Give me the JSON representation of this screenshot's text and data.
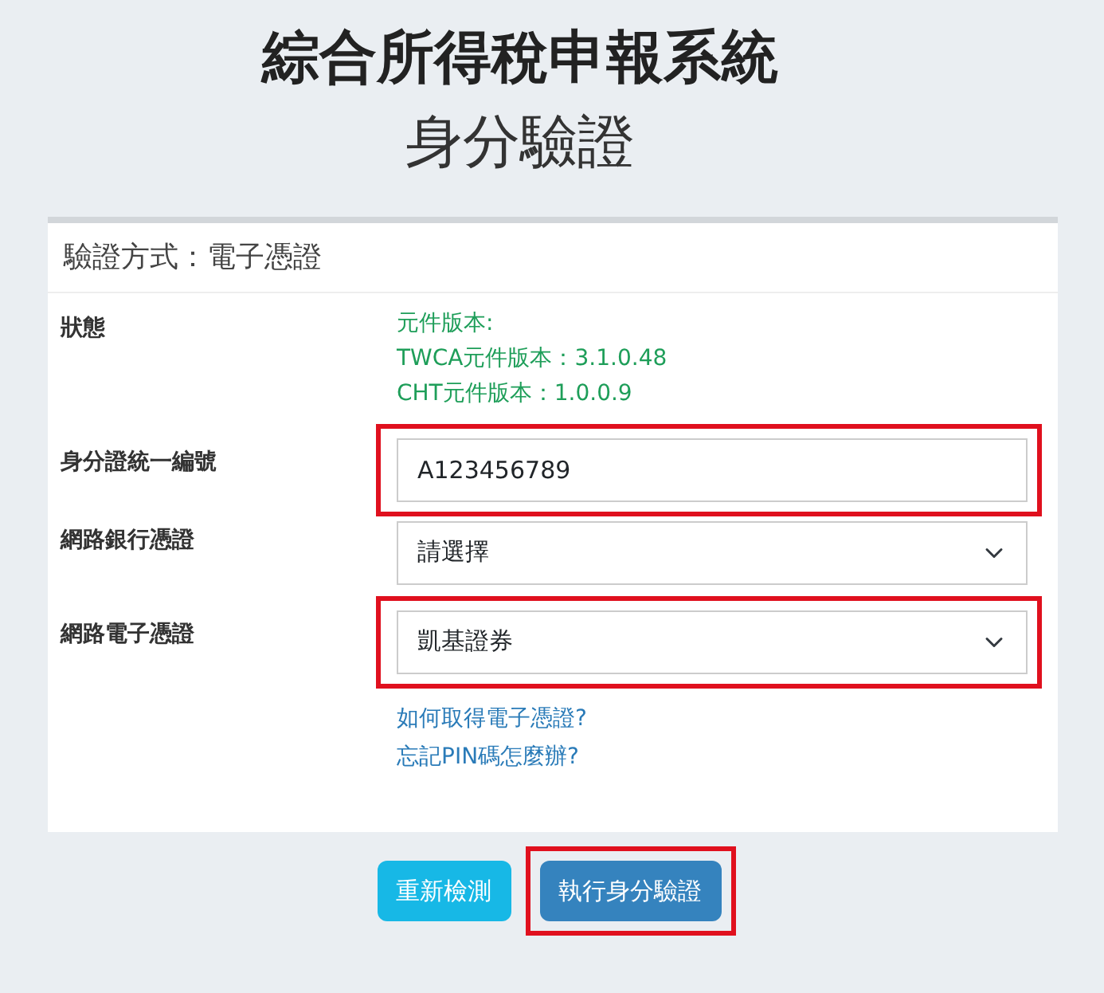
{
  "title": "綜合所得稅申報系統",
  "subtitle": "身分驗證",
  "card": {
    "header": "驗證方式：電子憑證",
    "rows": [
      {
        "kind": "status",
        "label": "狀態",
        "lines": [
          "元件版本:",
          "TWCA元件版本：3.1.0.48",
          "CHT元件版本：1.0.0.9"
        ]
      },
      {
        "kind": "input",
        "label": "身分證統一編號",
        "value": "A123456789",
        "highlighted": true
      },
      {
        "kind": "select",
        "label": "網路銀行憑證",
        "value": "請選擇",
        "highlighted": false
      },
      {
        "kind": "select",
        "label": "網路電子憑證",
        "value": "凱基證券",
        "highlighted": true,
        "links": [
          "如何取得電子憑證?",
          "忘記PIN碼怎麼辦?"
        ]
      }
    ]
  },
  "buttons": [
    {
      "label": "重新檢測",
      "kind": "info",
      "highlighted": false
    },
    {
      "label": "執行身分驗證",
      "kind": "primary",
      "highlighted": true
    }
  ]
}
